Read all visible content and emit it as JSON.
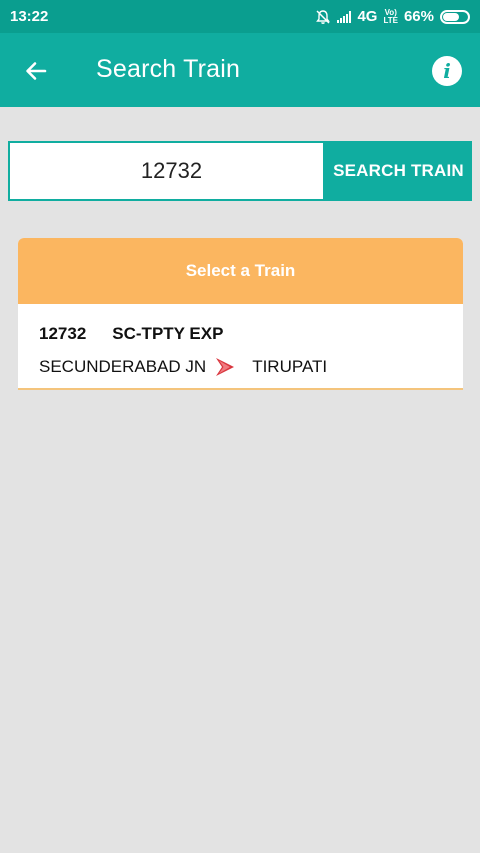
{
  "status_bar": {
    "time": "13:22",
    "network": "4G",
    "volte_top": "Vo)",
    "volte_bottom": "LTE",
    "battery": "66%",
    "battery_level": 0.66
  },
  "app_bar": {
    "title": "Search Train"
  },
  "search": {
    "value": "12732",
    "button_label": "SEARCH TRAIN"
  },
  "results": {
    "header": "Select a Train",
    "trains": [
      {
        "number": "12732",
        "name": "SC-TPTY EXP",
        "from": "SECUNDERABAD JN",
        "to": "TIRUPATI"
      }
    ]
  },
  "colors": {
    "primary": "#10ada0",
    "status_bar": "#0a9e8f",
    "header_orange": "#fbb660",
    "arrow_red": "#d9363e"
  }
}
